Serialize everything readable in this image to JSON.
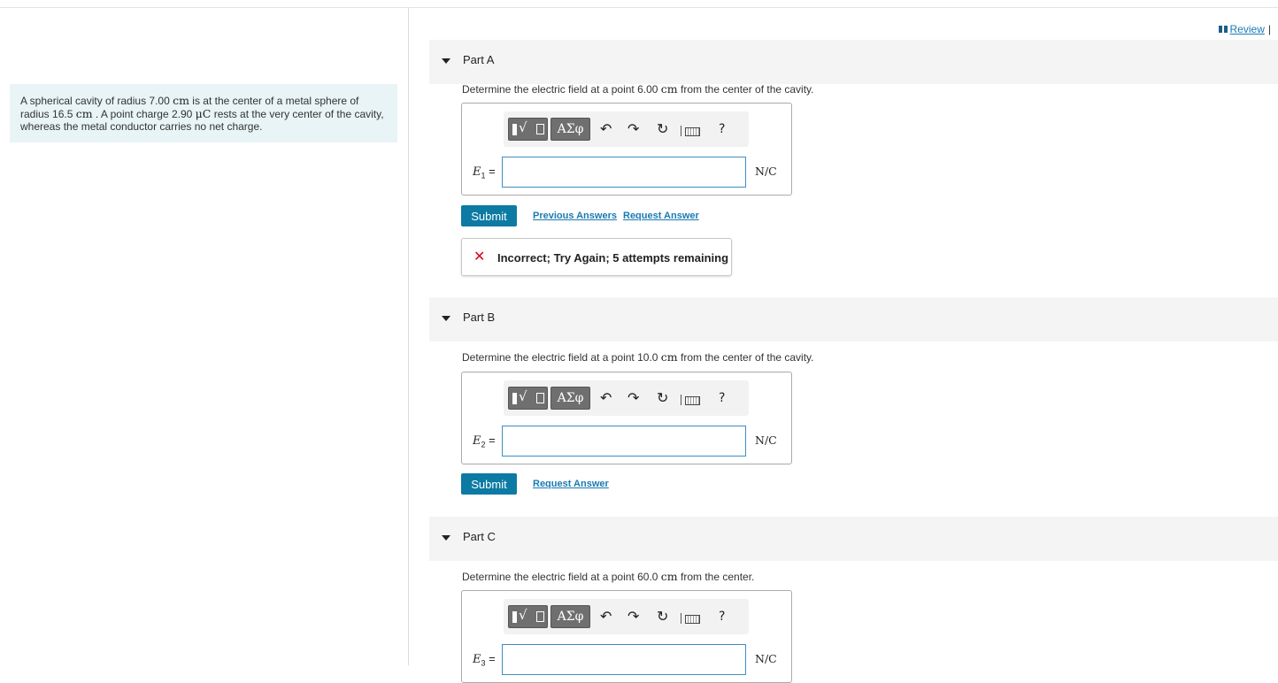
{
  "review": {
    "label": "Review",
    "separator": "|"
  },
  "problem": {
    "segments": [
      "A spherical cavity of radius 7.00 ",
      "cm",
      " is at the center of a metal sphere of radius 16.5 ",
      "cm",
      " . A point charge 2.90 ",
      "μC",
      " rests at the very center of the cavity, whereas the metal conductor carries no net charge."
    ]
  },
  "toolbar": {
    "template_icon": "fraction-radical-icon",
    "greek_label": "ΑΣφ",
    "undo_glyph": "↶",
    "redo_glyph": "↷",
    "reset_glyph": "↻",
    "keyboard_icon": "keyboard-icon",
    "help_label": "?"
  },
  "parts": [
    {
      "title": "Part A",
      "prompt_pre": "Determine the electric field at a point 6.00 ",
      "prompt_unit": "cm",
      "prompt_post": " from the center of the cavity.",
      "var_base": "E",
      "var_sub": "1",
      "equals": " =",
      "input_value": "",
      "unit": "N/C",
      "submit": "Submit",
      "previous_answers": "Previous Answers",
      "request_answer": "Request Answer",
      "feedback": "Incorrect; Try Again; 5 attempts remaining"
    },
    {
      "title": "Part B",
      "prompt_pre": "Determine the electric field at a point 10.0 ",
      "prompt_unit": "cm",
      "prompt_post": " from the center of the cavity.",
      "var_base": "E",
      "var_sub": "2",
      "equals": " =",
      "input_value": "",
      "unit": "N/C",
      "submit": "Submit",
      "request_answer": "Request Answer"
    },
    {
      "title": "Part C",
      "prompt_pre": "Determine the electric field at a point 60.0 ",
      "prompt_unit": "cm",
      "prompt_post": " from the center.",
      "var_base": "E",
      "var_sub": "3",
      "equals": " =",
      "input_value": "",
      "unit": "N/C"
    }
  ],
  "colors": {
    "accent": "#0c7aa3",
    "link": "#1a7ab3",
    "error": "#d9001b",
    "problem_bg": "#e8f4f6",
    "input_border": "#3b8fc4"
  }
}
